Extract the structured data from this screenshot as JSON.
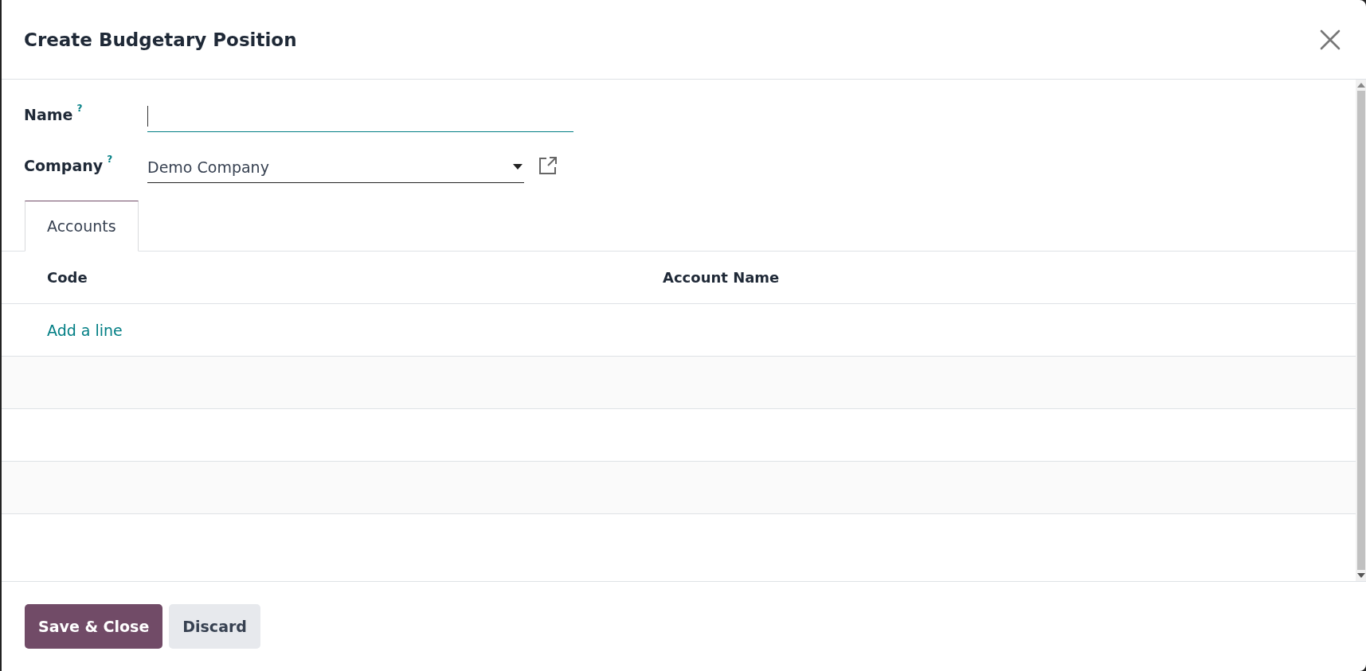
{
  "dialog": {
    "title": "Create Budgetary Position"
  },
  "fields": [
    {
      "label": "Name",
      "help": "?",
      "kind": "text",
      "focused": true
    },
    {
      "label": "Company",
      "help": "?",
      "kind": "select",
      "value": "Demo Company",
      "focused": false
    }
  ],
  "tabs": [
    {
      "label": "Accounts",
      "selected": true
    }
  ],
  "table": {
    "columns": [
      "Code",
      "Account Name"
    ],
    "add_line": "Add a line"
  },
  "buttons": [
    {
      "label": "Save & Close",
      "kind": "primary"
    },
    {
      "label": "Discard",
      "kind": "secondary"
    }
  ]
}
